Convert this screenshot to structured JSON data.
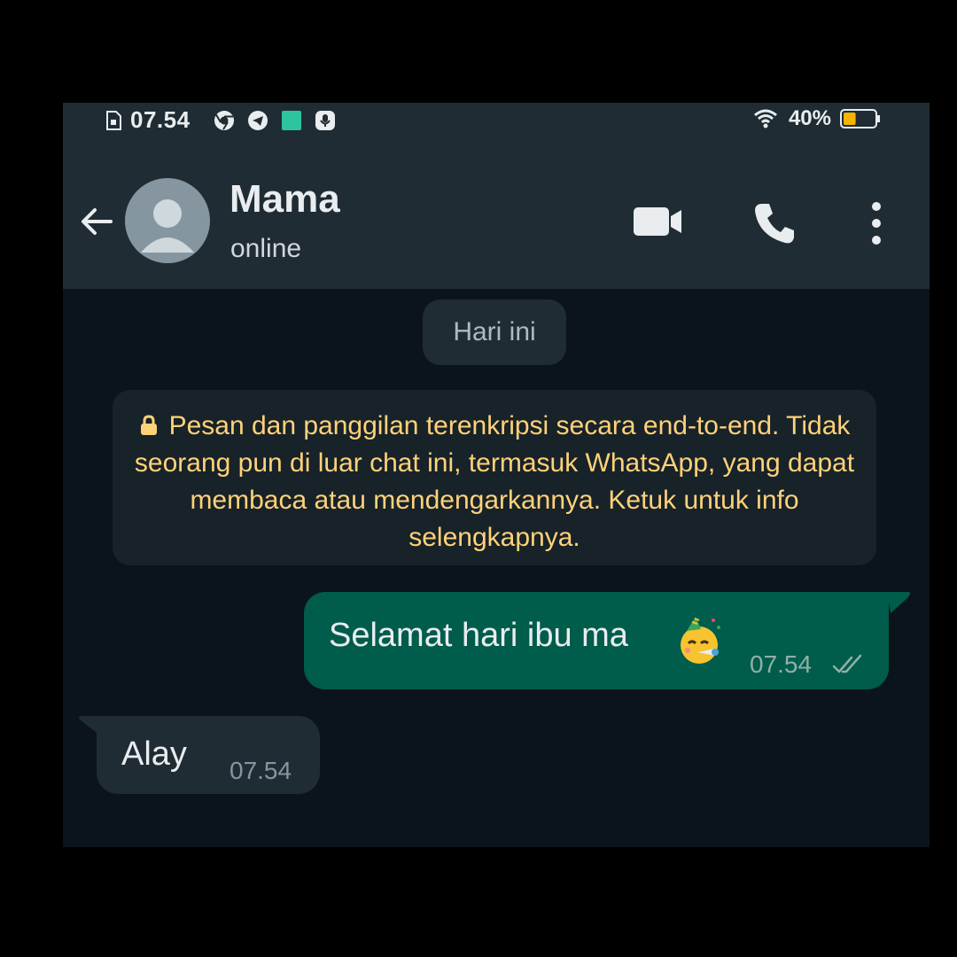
{
  "status_bar": {
    "time": "07.54",
    "battery_percent": "40%",
    "battery_level": 0.4,
    "icons": [
      "sim-icon",
      "chrome-icon",
      "telegram-icon",
      "app-icon",
      "mic-icon",
      "wifi-icon",
      "battery-icon"
    ]
  },
  "header": {
    "contact_name": "Mama",
    "contact_status": "online",
    "icons": [
      "back-arrow-icon",
      "avatar-icon",
      "video-call-icon",
      "phone-call-icon",
      "more-options-icon"
    ]
  },
  "chat": {
    "date_chip": "Hari ini",
    "encryption_notice": "Pesan dan panggilan terenkripsi secara end-to-end. Tidak seorang pun di luar chat ini, termasuk WhatsApp, yang dapat membaca atau mendengarkannya. Ketuk untuk info selengkapnya.",
    "messages": [
      {
        "direction": "outgoing",
        "text": "Selamat hari ibu ma",
        "emoji": "partying-face-emoji",
        "time": "07.54",
        "status": "read-ticks-icon"
      },
      {
        "direction": "incoming",
        "text": "Alay",
        "time": "07.54"
      }
    ]
  },
  "colors": {
    "header_bg": "#1f2c34",
    "chat_bg": "#0b141a",
    "outgoing_bubble": "#005c4b",
    "incoming_bubble": "#1f2c34",
    "encryption_text": "#ffd279"
  }
}
